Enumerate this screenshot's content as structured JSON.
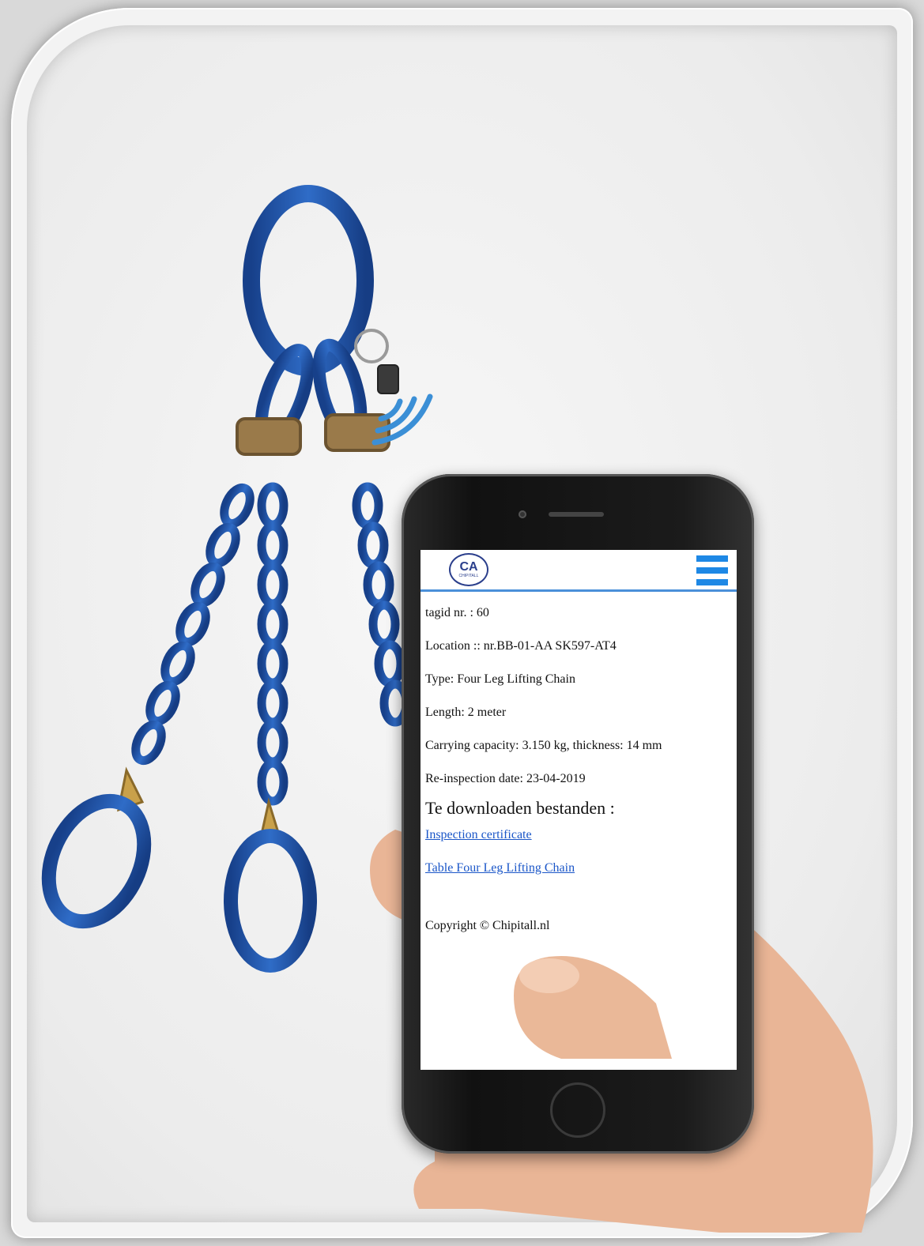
{
  "app": {
    "logo_mark": "CA",
    "logo_text": "CHIPITALL"
  },
  "details": {
    "tag": "tagid nr. : 60",
    "location": "Location :: nr.BB-01-AA SK597-AT4",
    "type": "Type: Four Leg Lifting Chain",
    "length": "Length: 2 meter",
    "capacity": "Carrying capacity: 3.150 kg, thickness: 14 mm",
    "reinspection": "Re-inspection date: 23-04-2019"
  },
  "downloads": {
    "heading": "Te downloaden bestanden :",
    "links": [
      "Inspection certificate",
      "Table Four Leg Lifting Chain"
    ]
  },
  "footer": {
    "copyright": "Copyright © Chipitall.nl"
  },
  "icons": {
    "logo": "chipitall-logo-icon",
    "menu": "hamburger-menu-icon",
    "nfc": "nfc-signal-icon"
  },
  "colors": {
    "accent": "#1e88e5",
    "link": "#1a56c8",
    "chain": "#1f4fa0"
  }
}
